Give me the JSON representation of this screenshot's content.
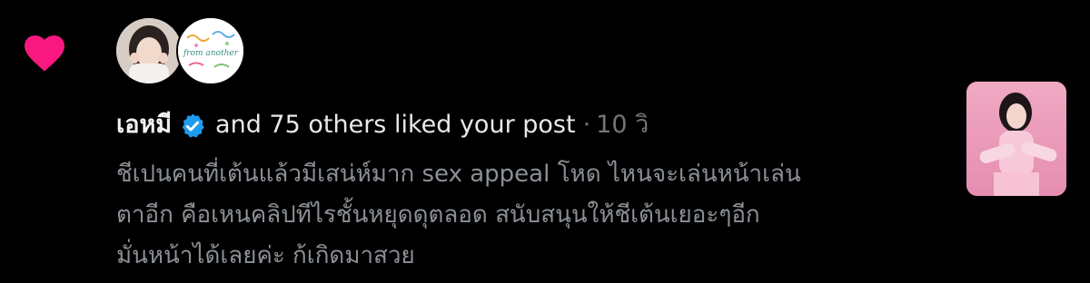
{
  "notification": {
    "type_icon": "heart-icon",
    "accent_color": "#f91880",
    "avatars": [
      {
        "icon": "user-photo-avatar"
      },
      {
        "icon": "illustrated-avatar",
        "text": "from another"
      }
    ],
    "user_name": "เอหมี",
    "verified_icon": "verified-badge-icon",
    "verified_color": "#1d9bf0",
    "liked_text": "and 75 others liked your post",
    "separator": "·",
    "time": "10 วิ",
    "post_text": "ชีเปนคนที่เต้นแล้วมีเสน่ห์มาก sex appeal โหด ไหนจะเล่นหน้าเล่น\nตาอีก คือเหนคลิปทีไรชั้นหยุดดุตลอด สนับสนุนให้ชีเต้นเยอะๆอีก\nมั่นหน้าได้เลยค่ะ ก้เกิดมาสวย",
    "thumbnail_icon": "post-image-thumbnail"
  }
}
